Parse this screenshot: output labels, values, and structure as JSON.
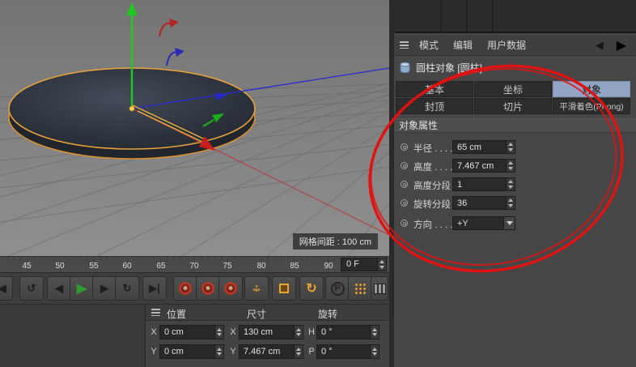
{
  "colors": {
    "selection_outline": "#e8a23c",
    "axis_x": "#c23232",
    "axis_y": "#21c821",
    "axis_z": "#2a2ad0",
    "active_tab": "#93a5c4",
    "annotation": "#e01212"
  },
  "viewport": {
    "grid_label": "网格间距 : 100 cm"
  },
  "attribute_manager": {
    "menu": {
      "mode": "模式",
      "edit": "编辑",
      "user_data": "用户数据"
    },
    "nav": {
      "back": "◀",
      "forward": "▶"
    },
    "object_title": "圆柱对象 [圆柱]",
    "tabs": [
      "基本",
      "坐标",
      "对象",
      "封顶",
      "切片",
      "平滑着色(Phong)"
    ],
    "active_tab": "对象",
    "section": "对象属性",
    "fields": [
      {
        "label": "半径 . . . .",
        "value": "65 cm",
        "type": "number"
      },
      {
        "label": "高度 . . . .",
        "value": "7.467 cm",
        "type": "number"
      },
      {
        "label": "高度分段",
        "value": "1",
        "type": "number"
      },
      {
        "label": "旋转分段",
        "value": "36",
        "type": "number"
      },
      {
        "label": "方向 . . . .",
        "value": "+Y",
        "type": "dropdown"
      }
    ]
  },
  "timeline": {
    "ticks": [
      "45",
      "50",
      "55",
      "60",
      "65",
      "70",
      "75",
      "80",
      "85",
      "90"
    ],
    "frame": "0 F"
  },
  "transport": {
    "buttons": [
      {
        "name": "goto-start",
        "glyph": "|◀"
      },
      {
        "name": "play-backwards",
        "glyph": "↺"
      },
      {
        "name": "previous-frame",
        "glyph": "◀"
      },
      {
        "name": "play",
        "glyph": "▶"
      },
      {
        "name": "next-frame",
        "glyph": "▶"
      },
      {
        "name": "cycle-range",
        "glyph": "↻"
      },
      {
        "name": "goto-end",
        "glyph": "▶|"
      }
    ],
    "tools": {
      "move_h": "↔",
      "move_v": "↕",
      "rotate_glyph": "↻",
      "p_label": "P"
    }
  },
  "coordinates": {
    "headers": [
      "位置",
      "尺寸",
      "旋转"
    ],
    "rows": [
      {
        "pos_axis": "X",
        "pos": "0 cm",
        "size_axis": "X",
        "size": "130 cm",
        "rot_axis": "H",
        "rot": "0 °"
      },
      {
        "pos_axis": "Y",
        "pos": "0 cm",
        "size_axis": "Y",
        "size": "7.467 cm",
        "rot_axis": "P",
        "rot": "0 °"
      }
    ]
  }
}
